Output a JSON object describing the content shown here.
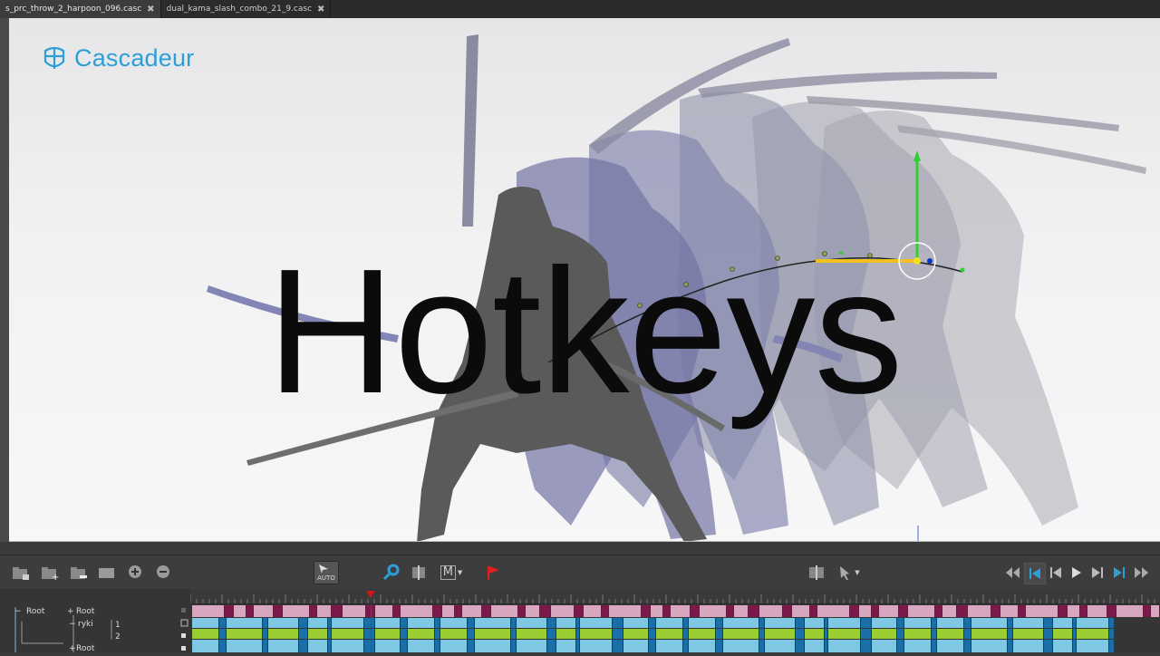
{
  "tabs": [
    {
      "label": "s_prc_throw_2_harpoon_096.casc",
      "close": "✖",
      "active": true
    },
    {
      "label": "dual_kama_slash_combo_21_9.casc",
      "close": "✖",
      "active": false
    }
  ],
  "logo": {
    "text": "Cascadeur",
    "icon": "cascadeur-logo-icon",
    "color": "#2c9fd6"
  },
  "overlay_title": "Hotkeys",
  "toolbar": {
    "left_icons": [
      "new-folder-icon",
      "add-folder-icon",
      "remove-folder-icon",
      "frame-icon",
      "zoom-in-icon",
      "zoom-out-icon"
    ],
    "auto_label": "AUTO",
    "mode_label": "M",
    "center_icons": [
      "key-icon",
      "split-icon",
      "mode-icon",
      "flag-icon"
    ],
    "right_icons": [
      "split-view-icon",
      "pin-icon"
    ],
    "playback_icons": [
      "rewind-icon",
      "first-frame-icon",
      "prev-key-icon",
      "play-icon",
      "next-key-icon",
      "last-frame-icon",
      "fast-forward-icon"
    ],
    "accent_key": "#2c9fd6",
    "accent_flag": "#e02020"
  },
  "timeline": {
    "tree": {
      "root_left": "Root",
      "root_right": "Root",
      "child": "ryki",
      "root_bottom": "Root",
      "row1_num": "1",
      "row2_num": "2"
    },
    "colors": {
      "row0_dark": "#7a1a4a",
      "row0_light": "#d9a6c0",
      "light_blue": "#7ec8e3",
      "dark_blue": "#1a6fa8",
      "green": "#9acd32",
      "playhead": "#d01818"
    },
    "playhead_frame": 0.186
  }
}
